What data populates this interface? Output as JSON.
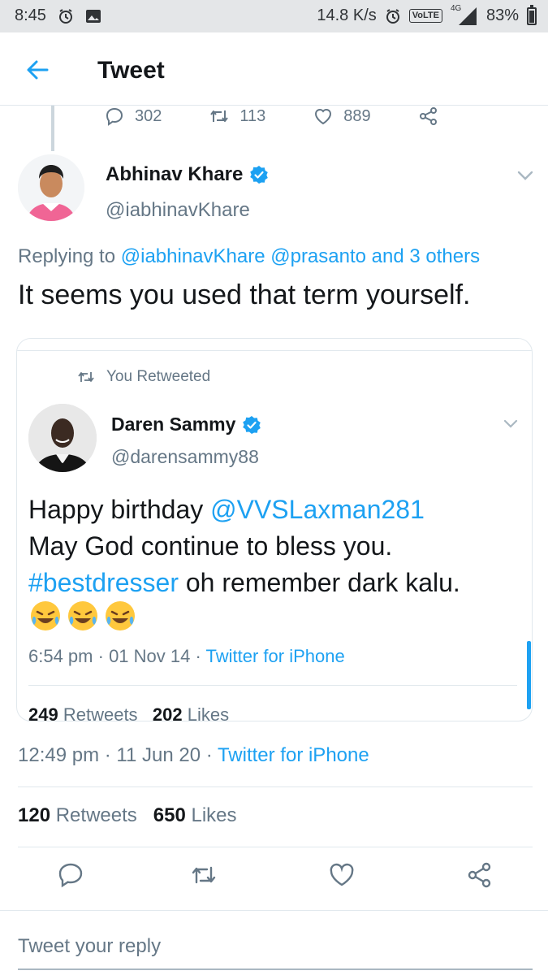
{
  "status_bar": {
    "time": "8:45",
    "net_speed": "14.8 K/s",
    "volte": "VoLTE",
    "network": "4G",
    "battery": "83%"
  },
  "header": {
    "title": "Tweet"
  },
  "prev_tweet_actions": {
    "replies": "302",
    "retweets": "113",
    "likes": "889"
  },
  "tweet": {
    "author_name": "Abhinav Khare",
    "author_handle": "@iabhinavKhare",
    "replying_prefix": "Replying to ",
    "replying_mentions": "@iabhinavKhare @prasanto and 3 others",
    "text": "It seems you used that term yourself.",
    "time": "12:49 pm",
    "date": "11 Jun 20",
    "client": "Twitter for iPhone",
    "retweet_count": "120",
    "retweets_label": "Retweets",
    "like_count": "650",
    "likes_label": "Likes"
  },
  "quoted": {
    "retweeted_label": "You Retweeted",
    "author_name": "Daren Sammy",
    "author_handle": "@darensammy88",
    "line1_prefix": "Happy birthday ",
    "line1_mention": "@VVSLaxman281",
    "line2": "May God continue to bless you.",
    "line3_hashtag": "#bestdresser",
    "line3_rest": " oh remember dark kalu.",
    "emoji": "😂😂😂",
    "time": "6:54 pm",
    "date": "01 Nov 14",
    "client": "Twitter for iPhone",
    "retweet_count": "249",
    "retweets_label": "Retweets",
    "like_count": "202",
    "likes_label": "Likes"
  },
  "reply_box": {
    "placeholder": "Tweet your reply"
  },
  "icons": {
    "back": "back-arrow-icon",
    "reply": "reply-bubble-icon",
    "retweet": "retweet-icon",
    "like": "heart-icon",
    "share": "share-icon",
    "verified": "verified-badge-icon",
    "more": "chevron-down-icon"
  },
  "colors": {
    "accent": "#1da1f2",
    "muted": "#657786",
    "text": "#14171a",
    "divider": "#e1e8ed"
  }
}
